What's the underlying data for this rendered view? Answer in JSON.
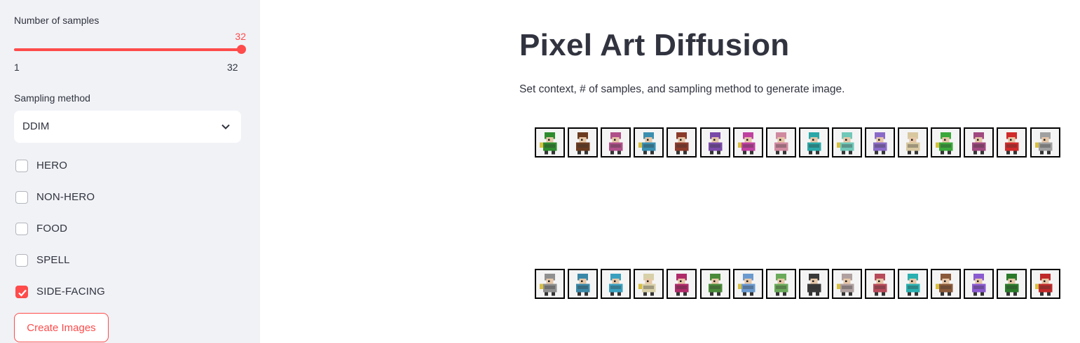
{
  "sidebar": {
    "samples_label": "Number of samples",
    "samples_value": "32",
    "samples_min": "1",
    "samples_max": "32",
    "samples_fraction": 1.0,
    "method_label": "Sampling method",
    "method_value": "DDIM",
    "contexts": [
      {
        "label": "HERO",
        "checked": false
      },
      {
        "label": "NON-HERO",
        "checked": false
      },
      {
        "label": "FOOD",
        "checked": false
      },
      {
        "label": "SPELL",
        "checked": false
      },
      {
        "label": "SIDE-FACING",
        "checked": true
      }
    ],
    "create_button": "Create Images"
  },
  "main": {
    "title": "Pixel Art Diffusion",
    "description": "Set context, # of samples, and sampling method to generate image."
  },
  "accent_color": "#ff4b4b",
  "sprite_rows": [
    [
      "#2e8b2e",
      "#6b3b1f",
      "#b0508a",
      "#3a8fb0",
      "#8b3a2a",
      "#7a4aa8",
      "#c040a0",
      "#d08aa0",
      "#2aa8a8",
      "#6fc8b8",
      "#8a6ac8",
      "#d8c8a0",
      "#3aa83a",
      "#a04880",
      "#d02a2a",
      "#a0a0a0"
    ],
    [
      "#909090",
      "#3a88a8",
      "#3aa0c0",
      "#d8d0a8",
      "#b02a6a",
      "#4a8a3a",
      "#6a9ad0",
      "#6aaa5a",
      "#3a3a3a",
      "#b0a0a0",
      "#b84a5a",
      "#2ab0b0",
      "#8a5a3a",
      "#8a5ad0",
      "#2a7a2a",
      "#c02a2a"
    ]
  ]
}
